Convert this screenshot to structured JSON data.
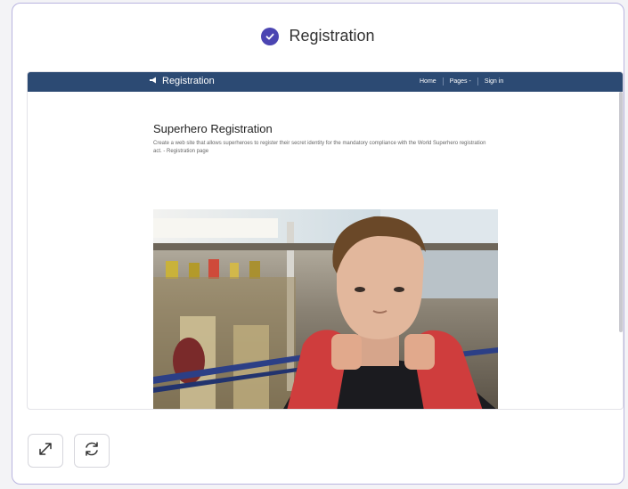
{
  "header": {
    "title": "Registration",
    "status_icon": "check-circle-icon",
    "accent_color": "#4b45b2"
  },
  "preview": {
    "navbar": {
      "brand": "Registration",
      "brand_icon": "bullhorn-icon",
      "links": [
        "Home",
        "Pages -",
        "Sign in"
      ],
      "background": "#2c4a73"
    },
    "content": {
      "title": "Superhero Registration",
      "description": "Create a web site that allows superheroes to register their secret identity for the mandatory compliance with the World Superhero registration act. - Registration page"
    },
    "image": "boxer-portrait-photo"
  },
  "toolbar": {
    "expand_icon": "expand-arrows-icon",
    "refresh_icon": "refresh-icon"
  }
}
